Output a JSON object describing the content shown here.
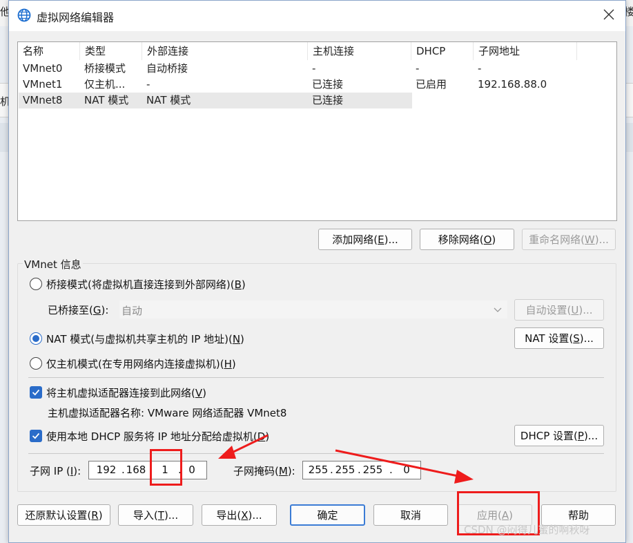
{
  "background": {
    "left_text_top": "他",
    "right_text_top": "楼",
    "left_text_mid": "机"
  },
  "window": {
    "title": "虚拟网络编辑器",
    "icon": "globe-icon",
    "close_glyph": "✕"
  },
  "table": {
    "columns": [
      "名称",
      "类型",
      "外部连接",
      "主机连接",
      "DHCP",
      "子网地址"
    ],
    "rows": [
      [
        "VMnet0",
        "桥接模式",
        "自动桥接",
        "-",
        "-",
        "-"
      ],
      [
        "VMnet1",
        "仅主机...",
        "-",
        "已连接",
        "已启用",
        "192.168.88.0"
      ],
      [
        "VMnet8",
        "NAT 模式",
        "NAT 模式",
        "已连接",
        "",
        ""
      ]
    ],
    "selected_row": 2
  },
  "list_buttons": {
    "add_pre": "添加网络(",
    "add_key": "E",
    "add_post": ")...",
    "remove_pre": "移除网络(",
    "remove_key": "O",
    "remove_post": ")",
    "rename_pre": "重命名网络(",
    "rename_key": "W",
    "rename_post": ")..."
  },
  "vmnet_info": {
    "group_label": "VMnet 信息",
    "bridged": {
      "pre": "桥接模式(将虚拟机直接连接到外部网络)(",
      "key": "B",
      "post": ")"
    },
    "bridged_to": {
      "pre": "已桥接至(",
      "key": "G",
      "post": "):",
      "value": "自动"
    },
    "auto_settings": {
      "pre": "自动设置(",
      "key": "U",
      "post": ")..."
    },
    "nat": {
      "pre": "NAT 模式(与虚拟机共享主机的 IP 地址)(",
      "key": "N",
      "post": ")"
    },
    "nat_settings": {
      "pre": "NAT 设置(",
      "key": "S",
      "post": ")..."
    },
    "hostonly": {
      "pre": "仅主机模式(在专用网络内连接虚拟机)(",
      "key": "H",
      "post": ")"
    },
    "connect_adapter": {
      "pre": "将主机虚拟适配器连接到此网络(",
      "key": "V",
      "post": ")"
    },
    "adapter_name": "主机虚拟适配器名称: VMware 网络适配器 VMnet8",
    "use_dhcp": {
      "pre": "使用本地 DHCP 服务将 IP 地址分配给虚拟机(",
      "key": "D",
      "post": ")"
    },
    "dhcp_settings": {
      "pre": "DHCP 设置(",
      "key": "P",
      "post": ")..."
    },
    "subnet_ip": {
      "pre": "子网 IP (",
      "key": "I",
      "post": "):",
      "octets": [
        "192",
        "168",
        "1",
        "0"
      ]
    },
    "subnet_mask": {
      "pre": "子网掩码(",
      "key": "M",
      "post": "):",
      "octets": [
        "255",
        "255",
        "255",
        "0"
      ]
    }
  },
  "footer": {
    "restore": {
      "pre": "还原默认设置(",
      "key": "R",
      "post": ")"
    },
    "import": {
      "pre": "导入(",
      "key": "T",
      "post": ")..."
    },
    "export": {
      "pre": "导出(",
      "key": "X",
      "post": ")..."
    },
    "ok": "确定",
    "cancel": "取消",
    "apply": {
      "pre": "应用(",
      "key": "A",
      "post": ")"
    },
    "help": "帮助"
  },
  "watermark": "CSDN @闷得儿蜜的啊秋呀",
  "colors": {
    "accent": "#2a6cc9",
    "annotation": "#ee1c1c"
  }
}
